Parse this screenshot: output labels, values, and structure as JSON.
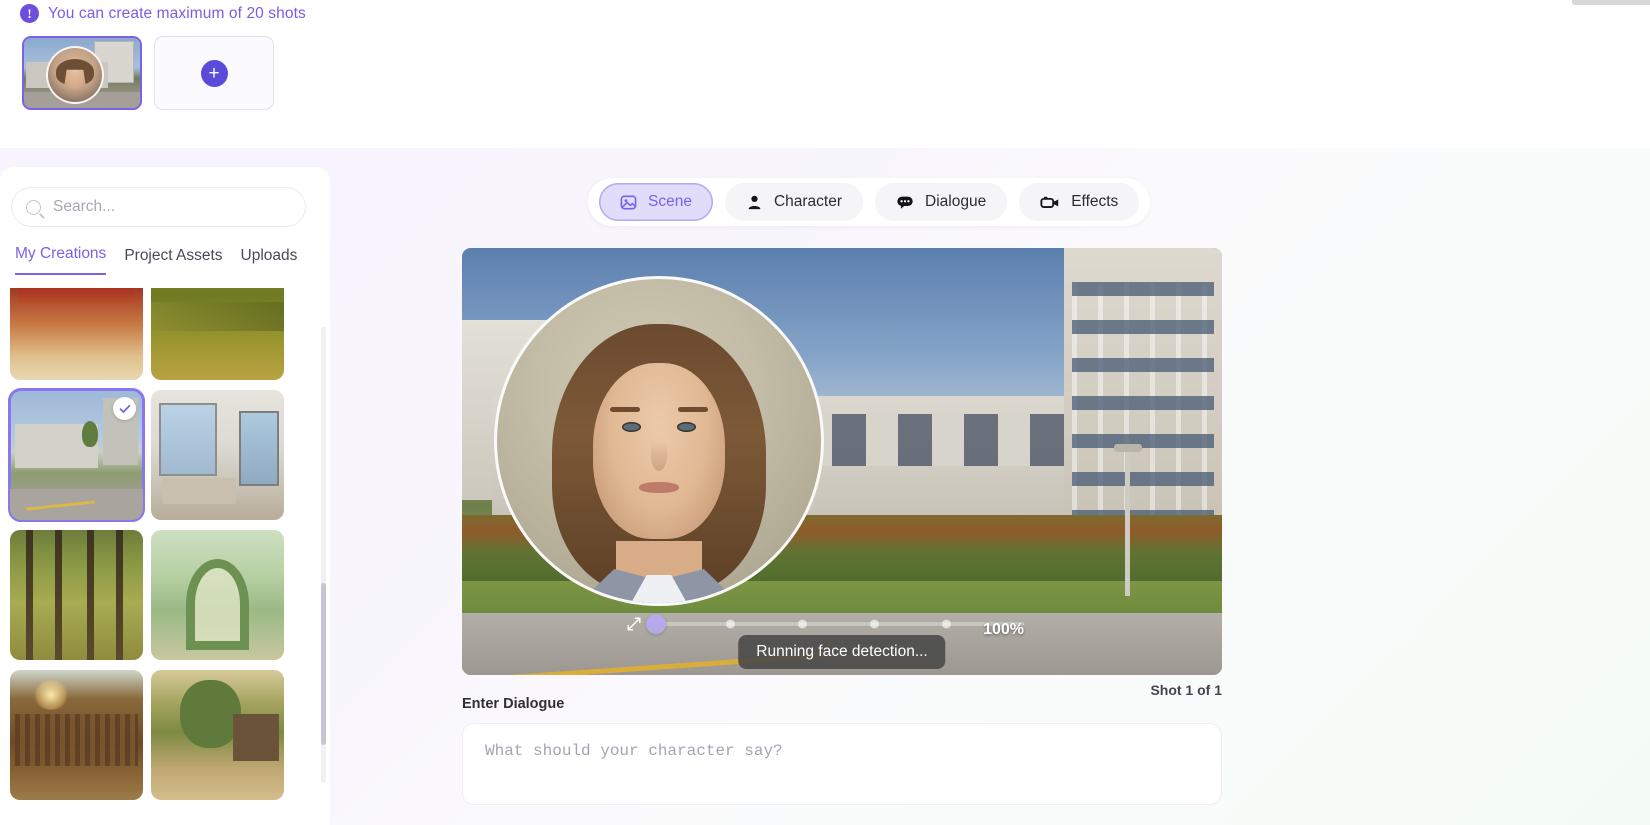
{
  "notice": {
    "icon": "exclamation-icon",
    "text": "You can create maximum of 20 shots"
  },
  "shots": {
    "add_label": "+",
    "items": [
      {
        "name": "shot-1",
        "selected": true
      }
    ]
  },
  "sidebar": {
    "search": {
      "placeholder": "Search...",
      "value": "",
      "icon": "search-icon"
    },
    "tabs": [
      {
        "label": "My Creations",
        "active": true
      },
      {
        "label": "Project Assets",
        "active": false
      },
      {
        "label": "Uploads",
        "active": false
      }
    ],
    "assets": [
      {
        "name": "theater-interior",
        "selected": false
      },
      {
        "name": "golden-field",
        "selected": false
      },
      {
        "name": "campus-building",
        "selected": true
      },
      {
        "name": "modern-bedroom",
        "selected": false
      },
      {
        "name": "sunlit-forest",
        "selected": false
      },
      {
        "name": "garden-arch",
        "selected": false
      },
      {
        "name": "grand-library",
        "selected": false
      },
      {
        "name": "rustic-barn",
        "selected": false
      }
    ]
  },
  "mode_tabs": [
    {
      "label": "Scene",
      "icon": "image-icon",
      "active": true
    },
    {
      "label": "Character",
      "icon": "person-icon",
      "active": false
    },
    {
      "label": "Dialogue",
      "icon": "speech-bubble-icon",
      "active": false
    },
    {
      "label": "Effects",
      "icon": "video-camera-icon",
      "active": false
    }
  ],
  "preview": {
    "zoom_level": "100%",
    "status_tooltip": "Running face detection...",
    "shot_counter": "Shot 1 of 1",
    "resize_icon": "resize-arrows-icon"
  },
  "dialogue": {
    "label": "Enter Dialogue",
    "placeholder": "What should your character say?",
    "value": ""
  },
  "colors": {
    "accent": "#7b61e8",
    "accent_solid": "#5b4bdb",
    "accent_soft": "#e0dcfa",
    "text": "#2c2c35",
    "muted": "#a9a7b4"
  }
}
